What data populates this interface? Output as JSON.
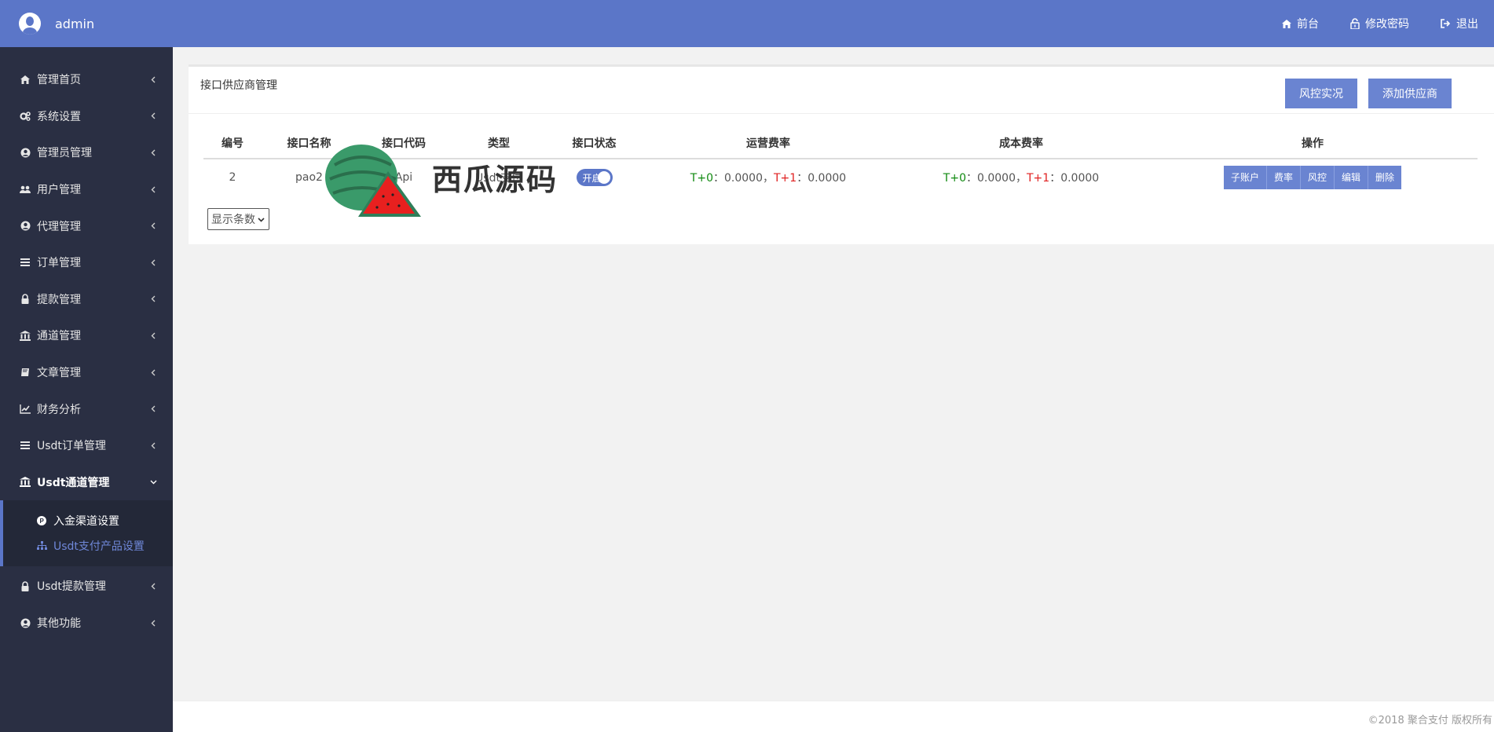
{
  "header": {
    "username": "admin",
    "links": {
      "frontend": "前台",
      "change_password": "修改密码",
      "logout": "退出"
    },
    "bg_color": "#5b76c8"
  },
  "sidebar": {
    "items": [
      {
        "label": "管理首页",
        "icon": "home-icon"
      },
      {
        "label": "系统设置",
        "icon": "gears-icon"
      },
      {
        "label": "管理员管理",
        "icon": "user-circle-icon"
      },
      {
        "label": "用户管理",
        "icon": "users-icon"
      },
      {
        "label": "代理管理",
        "icon": "user-circle-icon"
      },
      {
        "label": "订单管理",
        "icon": "list-icon"
      },
      {
        "label": "提款管理",
        "icon": "lock-icon"
      },
      {
        "label": "通道管理",
        "icon": "bank-icon"
      },
      {
        "label": "文章管理",
        "icon": "book-icon"
      },
      {
        "label": "财务分析",
        "icon": "line-chart-icon"
      },
      {
        "label": "Usdt订单管理",
        "icon": "list-icon"
      },
      {
        "label": "Usdt通道管理",
        "icon": "bank-icon"
      },
      {
        "label": "Usdt提款管理",
        "icon": "lock-icon"
      },
      {
        "label": "其他功能",
        "icon": "user-circle-icon"
      }
    ],
    "submenu": [
      {
        "label": "入金渠道设置",
        "icon": "paypal-icon"
      },
      {
        "label": "Usdt支付产品设置",
        "icon": "sitemap-icon"
      }
    ],
    "bg_color": "#2a2f43"
  },
  "panel": {
    "title": "接口供应商管理",
    "risk_button": "风控实况",
    "add_button": "添加供应商",
    "columns": [
      "编号",
      "接口名称",
      "接口代码",
      "类型",
      "接口状态",
      "运营费率",
      "成本费率",
      "操作"
    ],
    "rows": [
      {
        "id": "2",
        "name": "pao2",
        "code": "Api",
        "type": "Usdt支付",
        "status_label": "开启",
        "op_rate": {
          "t0_label": "T+0",
          "t0_value": "：0.0000，",
          "t1_label": "T+1",
          "t1_value": "：0.0000"
        },
        "cost_rate": {
          "t0_label": "T+0",
          "t0_value": "：0.0000，",
          "t1_label": "T+1",
          "t1_value": "：0.0000"
        },
        "actions": [
          "子账户",
          "费率",
          "风控",
          "编辑",
          "删除"
        ]
      }
    ],
    "page_size_label": "显示条数"
  },
  "watermark": {
    "text": "西瓜源码"
  },
  "footer": {
    "text": "©2018 聚合支付 版权所有"
  }
}
